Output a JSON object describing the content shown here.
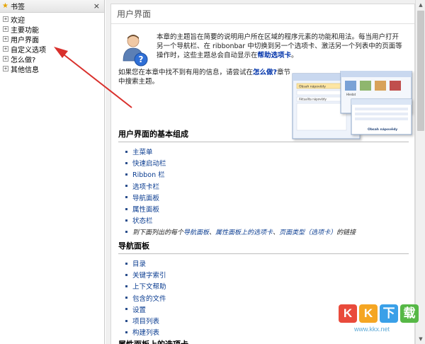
{
  "sidebar": {
    "title": "书签",
    "close": "×",
    "items": [
      {
        "label": "欢迎",
        "expander": "+"
      },
      {
        "label": "主要功能",
        "expander": "+"
      },
      {
        "label": "用户界面",
        "expander": "+"
      },
      {
        "label": "自定义选项",
        "expander": "+"
      },
      {
        "label": "怎么做?",
        "expander": "+"
      },
      {
        "label": "其他信息",
        "expander": "+"
      }
    ]
  },
  "page": {
    "title": "用户界面",
    "intro_text": "本章的主题旨在简要的说明用户所在区域的程序元素的功能和用法。每当用户打开另一个导航栏、在 ribbonbar 中切换到另一个选项卡、激活另一个列表中的页面等操作时，这些主题总会自动显示在",
    "intro_link": "帮助选项卡",
    "intro_end": "。",
    "notfound_text": "如果您在本章中找不到有用的信息，请尝试在",
    "notfound_link": "怎么做?",
    "notfound_end": "章节中搜索主题。",
    "shots_labels": {
      "a": "Obsah nápovědy",
      "b": "Aktualita nápovědy",
      "c": "Hledat",
      "d": "Obsah nápovědy"
    }
  },
  "sections": [
    {
      "heading": "用户界面的基本组成",
      "items": [
        "主菜单",
        "快速启动栏",
        "Ribbon 栏",
        "选项卡栏",
        "导航面板",
        "属性面板",
        "状态栏"
      ],
      "note": {
        "prefix": "到下面列出的每个",
        "link1": "导航面板",
        "sep1": "、",
        "link2": "属性面板上的选项卡",
        "sep2": "、",
        "link3": "页面类型（选项卡）",
        "suffix": "的链接"
      }
    },
    {
      "heading": "导航面板",
      "items": [
        "目录",
        "关键字索引",
        "上下文帮助",
        "包含的文件",
        "设置",
        "项目列表",
        "构建列表"
      ]
    },
    {
      "heading": "属性面板上的选项卡"
    }
  ],
  "watermark": {
    "letters": [
      "K",
      "K",
      "下",
      "载"
    ],
    "colors": [
      "#e94b3c",
      "#f5a623",
      "#3aa0e8",
      "#56b846"
    ],
    "url": "www.kkx.net"
  }
}
